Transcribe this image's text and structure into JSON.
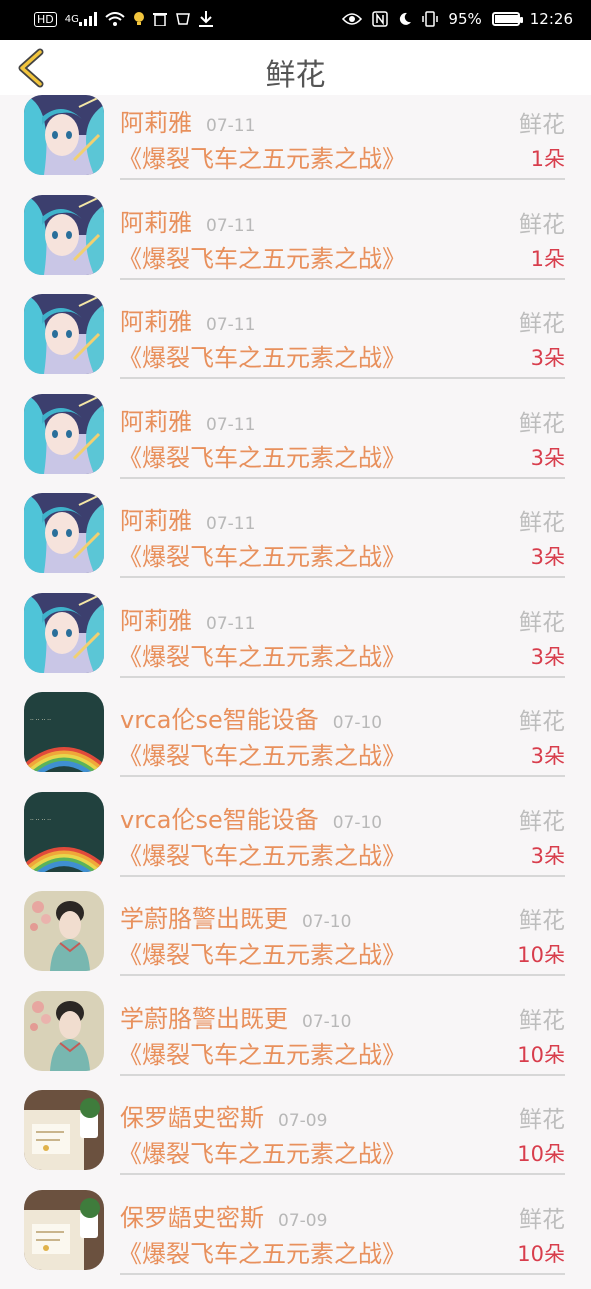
{
  "status_bar": {
    "time": "12:26",
    "battery": "95%",
    "battery_level": 0.95,
    "hd_label": "HD",
    "net_label": "4G"
  },
  "header": {
    "title": "鲜花"
  },
  "items": [
    {
      "name": "阿莉雅",
      "date": "07-11",
      "type": "鲜花",
      "message": "《爆裂飞车之五元素之战》",
      "count": "1朵",
      "avatar": "anime-girl"
    },
    {
      "name": "阿莉雅",
      "date": "07-11",
      "type": "鲜花",
      "message": "《爆裂飞车之五元素之战》",
      "count": "1朵",
      "avatar": "anime-girl"
    },
    {
      "name": "阿莉雅",
      "date": "07-11",
      "type": "鲜花",
      "message": "《爆裂飞车之五元素之战》",
      "count": "3朵",
      "avatar": "anime-girl"
    },
    {
      "name": "阿莉雅",
      "date": "07-11",
      "type": "鲜花",
      "message": "《爆裂飞车之五元素之战》",
      "count": "3朵",
      "avatar": "anime-girl"
    },
    {
      "name": "阿莉雅",
      "date": "07-11",
      "type": "鲜花",
      "message": "《爆裂飞车之五元素之战》",
      "count": "3朵",
      "avatar": "anime-girl"
    },
    {
      "name": "阿莉雅",
      "date": "07-11",
      "type": "鲜花",
      "message": "《爆裂飞车之五元素之战》",
      "count": "3朵",
      "avatar": "anime-girl"
    },
    {
      "name": "vrca伦se智能设备",
      "date": "07-10",
      "type": "鲜花",
      "message": "《爆裂飞车之五元素之战》",
      "count": "3朵",
      "avatar": "rainbow"
    },
    {
      "name": "vrca伦se智能设备",
      "date": "07-10",
      "type": "鲜花",
      "message": "《爆裂飞车之五元素之战》",
      "count": "3朵",
      "avatar": "rainbow"
    },
    {
      "name": "学蔚胳警出既更",
      "date": "07-10",
      "type": "鲜花",
      "message": "《爆裂飞车之五元素之战》",
      "count": "10朵",
      "avatar": "lady"
    },
    {
      "name": "学蔚胳警出既更",
      "date": "07-10",
      "type": "鲜花",
      "message": "《爆裂飞车之五元素之战》",
      "count": "10朵",
      "avatar": "lady"
    },
    {
      "name": "保罗龉史密斯",
      "date": "07-09",
      "type": "鲜花",
      "message": "《爆裂飞车之五元素之战》",
      "count": "10朵",
      "avatar": "desk"
    },
    {
      "name": "保罗龉史密斯",
      "date": "07-09",
      "type": "鲜花",
      "message": "《爆裂飞车之五元素之战》",
      "count": "10朵",
      "avatar": "desk"
    }
  ],
  "colors": {
    "accent_orange": "#e8905c",
    "count_red": "#d83d4c",
    "back_icon_yellow": "#f2c53d"
  }
}
